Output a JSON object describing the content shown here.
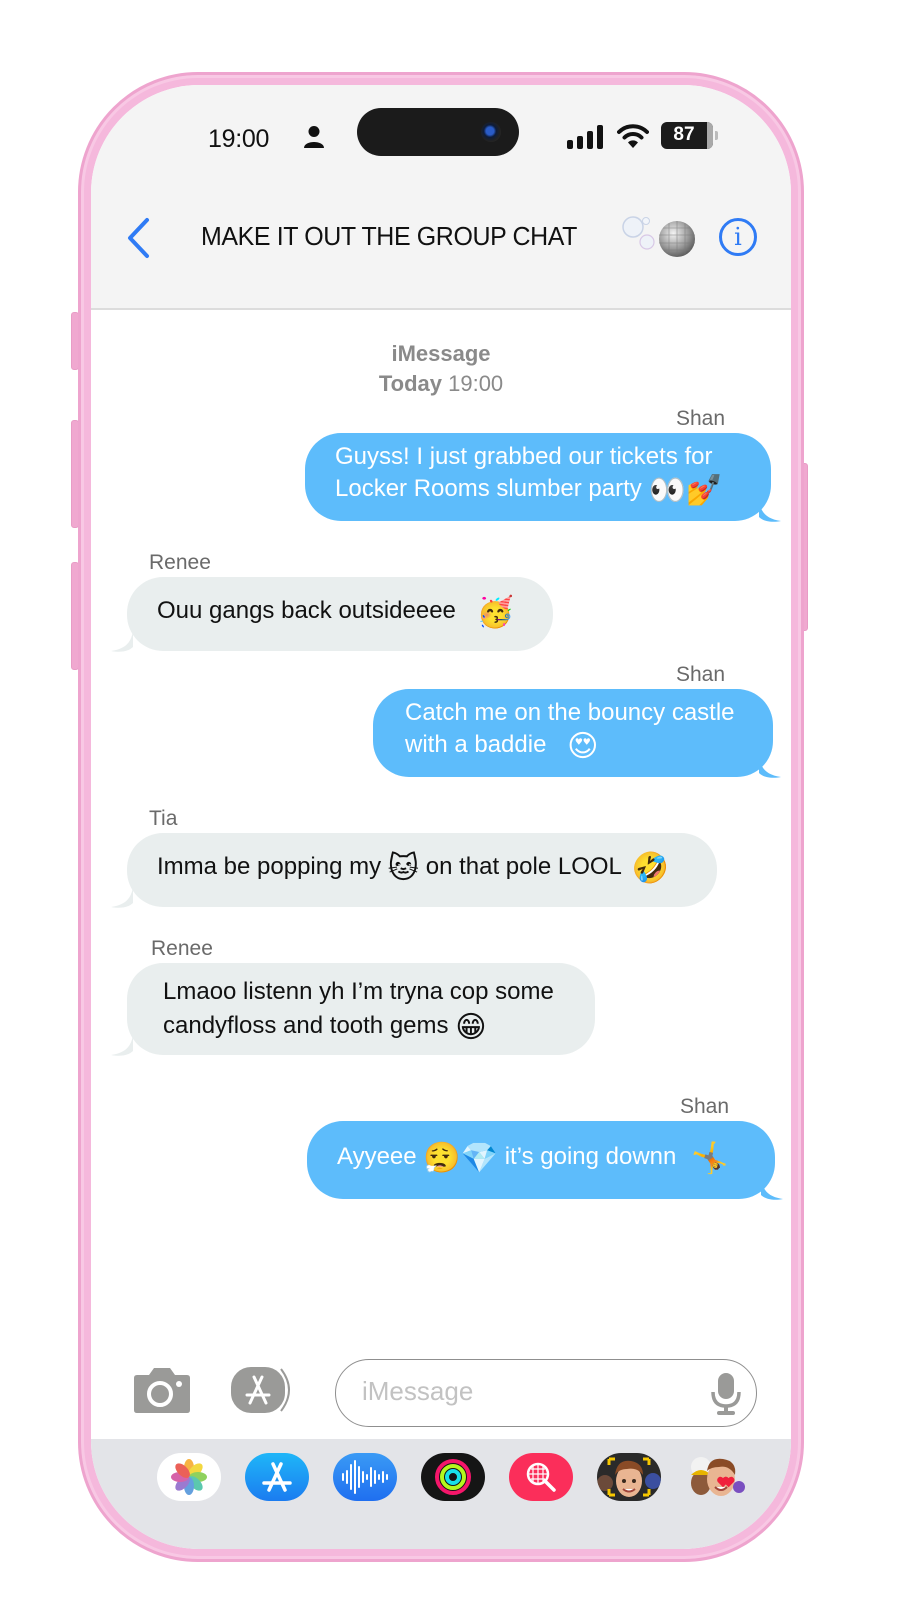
{
  "status_bar": {
    "time": "19:00",
    "battery_percent": "87",
    "icons": [
      "person-icon",
      "signal-icon",
      "wifi-icon",
      "battery-icon"
    ]
  },
  "header": {
    "back_icon": "chevron-left-icon",
    "title": "MAKE IT OUT THE GROUP CHAT",
    "title_emoji": [
      "bubbles",
      "mirror-ball"
    ],
    "info_icon": "info-icon",
    "info_label": "i",
    "accent_color": "#2f7bf5"
  },
  "thread": {
    "service": "iMessage",
    "day": "Today",
    "time": "19:00"
  },
  "messages": [
    {
      "sender": "Shan",
      "direction": "outgoing",
      "lines": [
        "Guyss! I just grabbed our tickets for",
        "Locker Rooms slumber party"
      ],
      "emoji": "👀💅"
    },
    {
      "sender": "Renee",
      "direction": "incoming",
      "lines": [
        "Ouu gangs back outsideeee"
      ],
      "emoji": "🥳"
    },
    {
      "sender": "Shan",
      "direction": "outgoing",
      "lines": [
        "Catch me on the bouncy castle",
        "with a baddie"
      ],
      "emoji": "😍"
    },
    {
      "sender": "Tia",
      "direction": "incoming",
      "text_before": "Imma be popping my",
      "emoji_mid": "🐱",
      "text_after": "on that pole LOOL",
      "emoji": "🤣"
    },
    {
      "sender": "Renee",
      "direction": "incoming",
      "lines": [
        "Lmaoo listenn yh I’m tryna cop some",
        "candyfloss and tooth gems"
      ],
      "emoji": "😁"
    },
    {
      "sender": "Shan",
      "direction": "outgoing",
      "text_before": "Ayyeee",
      "emoji_mid": "😮‍💨💎",
      "text_after": "it’s going downn",
      "emoji": "🤸"
    }
  ],
  "colors": {
    "outgoing_bubble": "#5dbcfb",
    "incoming_bubble": "#e9eeee",
    "frame": "#f5b8dc"
  },
  "composer": {
    "camera_icon": "camera-icon",
    "apps_icon": "app-store-icon",
    "placeholder": "iMessage",
    "value": "",
    "mic_icon": "microphone-icon"
  },
  "app_strip": {
    "apps": [
      {
        "name": "Photos",
        "icon": "photos-icon"
      },
      {
        "name": "App Store",
        "icon": "app-store-icon"
      },
      {
        "name": "Audio Message",
        "icon": "waveform-icon"
      },
      {
        "name": "Activity",
        "icon": "activity-rings-icon"
      },
      {
        "name": "Images Search",
        "icon": "globe-search-icon"
      },
      {
        "name": "Memoji",
        "icon": "memoji-icon"
      },
      {
        "name": "Memoji Stickers",
        "icon": "memoji-stickers-icon"
      }
    ]
  }
}
